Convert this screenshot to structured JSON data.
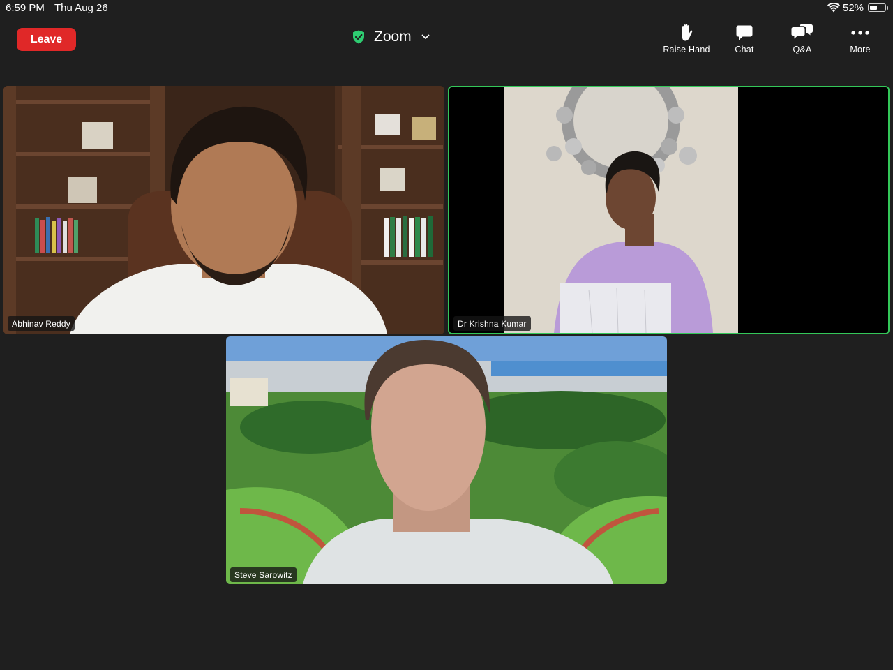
{
  "status_bar": {
    "time": "6:59 PM",
    "date": "Thu Aug 26",
    "battery_percent_label": "52%",
    "battery_level": 0.52
  },
  "toolbar": {
    "leave_label": "Leave",
    "meeting_title": "Zoom",
    "actions": [
      {
        "label": "Raise Hand",
        "icon": "raised-hand-icon"
      },
      {
        "label": "Chat",
        "icon": "chat-bubble-icon"
      },
      {
        "label": "Q&A",
        "icon": "qa-bubbles-icon"
      },
      {
        "label": "More",
        "icon": "ellipsis-icon"
      }
    ]
  },
  "participants": [
    {
      "name": "Abhinav Reddy",
      "active_speaker": false
    },
    {
      "name": "Dr Krishna Kumar",
      "active_speaker": true
    },
    {
      "name": "Steve Sarowitz",
      "active_speaker": false
    }
  ],
  "colors": {
    "background": "#1f1f1f",
    "leave_button": "#e02828",
    "active_speaker_border": "#34c759",
    "secure_shield": "#2ecc71"
  }
}
